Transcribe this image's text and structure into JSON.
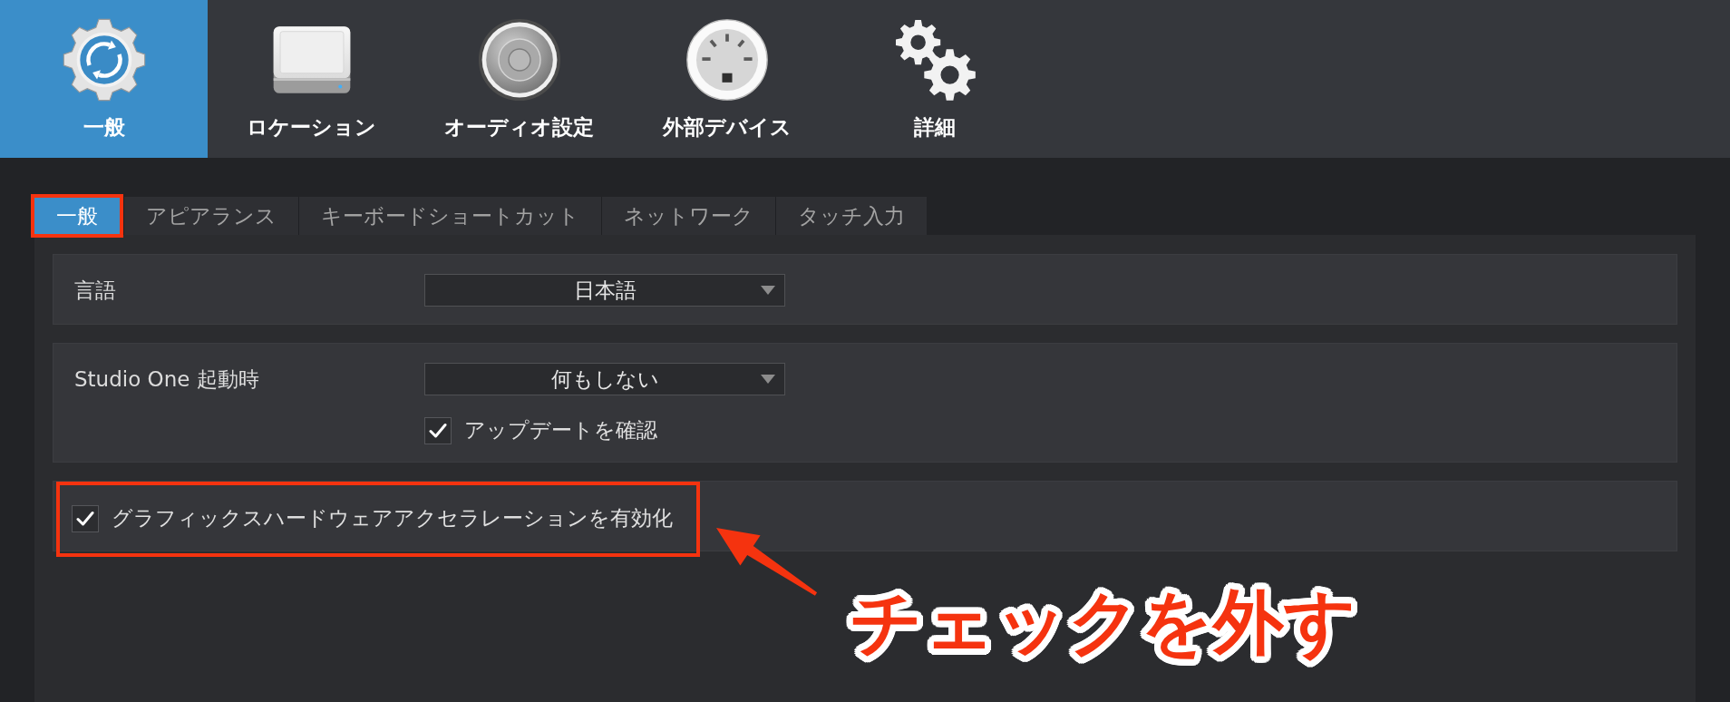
{
  "toolbar": {
    "items": [
      {
        "label": "一般",
        "selected": true
      },
      {
        "label": "ロケーション",
        "selected": false
      },
      {
        "label": "オーディオ設定",
        "selected": false
      },
      {
        "label": "外部デバイス",
        "selected": false
      },
      {
        "label": "詳細",
        "selected": false
      }
    ]
  },
  "tabs": [
    {
      "label": "一般",
      "selected": true,
      "highlighted": true
    },
    {
      "label": "アピアランス",
      "selected": false,
      "highlighted": false
    },
    {
      "label": "キーボードショートカット",
      "selected": false,
      "highlighted": false
    },
    {
      "label": "ネットワーク",
      "selected": false,
      "highlighted": false
    },
    {
      "label": "タッチ入力",
      "selected": false,
      "highlighted": false
    }
  ],
  "groups": [
    {
      "rows": [
        {
          "kind": "select",
          "label": "言語",
          "value": "日本語"
        }
      ]
    },
    {
      "rows": [
        {
          "kind": "select",
          "label": "Studio One 起動時",
          "value": "何もしない"
        },
        {
          "kind": "option",
          "label": "アップデートを確認",
          "checked": true
        }
      ]
    },
    {
      "rows": [
        {
          "kind": "checkbox",
          "label": "グラフィックスハードウェアアクセラレーションを有効化",
          "checked": true,
          "highlighted": true
        }
      ]
    }
  ],
  "callout": {
    "text": "チェックを外す"
  }
}
